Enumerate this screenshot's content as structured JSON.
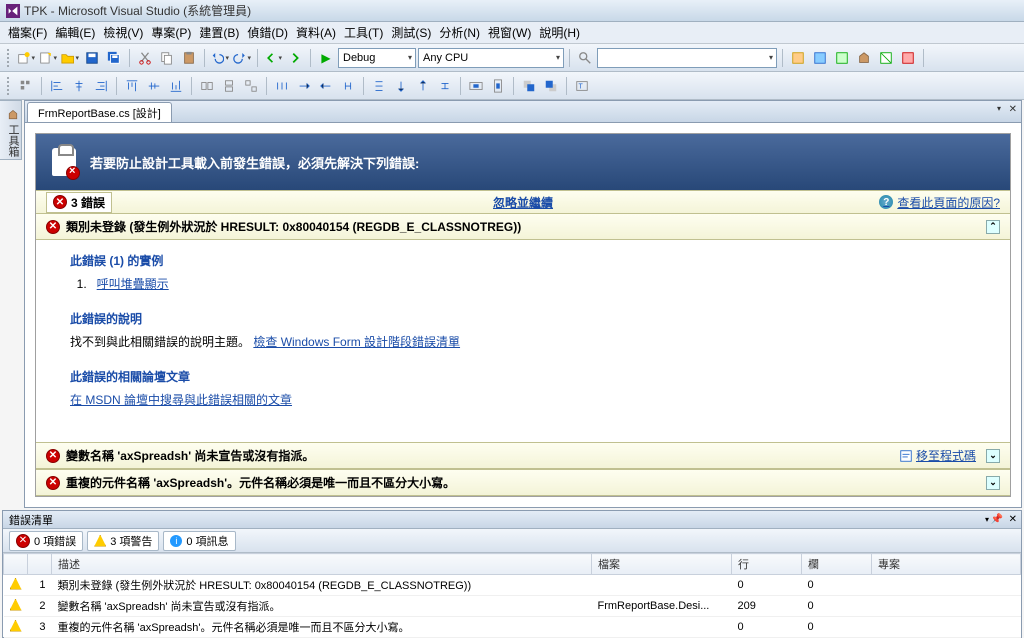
{
  "title": "TPK - Microsoft Visual Studio (系統管理員)",
  "menu": [
    {
      "label": "檔案(F)"
    },
    {
      "label": "編輯(E)"
    },
    {
      "label": "檢視(V)"
    },
    {
      "label": "專案(P)"
    },
    {
      "label": "建置(B)"
    },
    {
      "label": "偵錯(D)"
    },
    {
      "label": "資料(A)"
    },
    {
      "label": "工具(T)"
    },
    {
      "label": "測試(S)"
    },
    {
      "label": "分析(N)"
    },
    {
      "label": "視窗(W)"
    },
    {
      "label": "說明(H)"
    }
  ],
  "toolbar": {
    "config": "Debug",
    "platform": "Any CPU",
    "blank": ""
  },
  "lefttab": "工具箱",
  "doc": {
    "tab": "FrmReportBase.cs [設計]",
    "banner": "若要防止設計工具載入前發生錯誤，必須先解決下列錯誤:",
    "errcount": "3 錯誤",
    "ignore": "忽略並繼續",
    "why": "查看此頁面的原因?",
    "err1_title": "類別未登錄 (發生例外狀況於 HRESULT: 0x80040154 (REGDB_E_CLASSNOTREG))",
    "sec1_h": "此錯誤 (1) 的實例",
    "sec1_link": "呼叫堆疊顯示",
    "sec2_h": "此錯誤的說明",
    "sec2_txt": "找不到與此相關錯誤的說明主題。",
    "sec2_link": "檢查 Windows Form 設計階段錯誤清單",
    "sec3_h": "此錯誤的相關論壇文章",
    "sec3_link": "在 MSDN 論壇中搜尋與此錯誤相關的文章",
    "err2": "變數名稱 'axSpreadsh' 尚未宣告或沒有指派。",
    "goto": "移至程式碼",
    "err3": "重複的元件名稱 'axSpreadsh'。元件名稱必須是唯一而且不區分大小寫。"
  },
  "errorlist": {
    "title": "錯誤清單",
    "f_err": "0 項錯誤",
    "f_warn": "3 項警告",
    "f_msg": "0 項訊息",
    "cols": {
      "desc": "描述",
      "file": "檔案",
      "line": "行",
      "col": "欄",
      "proj": "專案"
    },
    "rows": [
      {
        "n": "1",
        "desc": "類別未登錄 (發生例外狀況於 HRESULT: 0x80040154 (REGDB_E_CLASSNOTREG))",
        "file": "",
        "line": "0",
        "col": "0",
        "proj": ""
      },
      {
        "n": "2",
        "desc": "變數名稱 'axSpreadsh' 尚未宣告或沒有指派。",
        "file": "FrmReportBase.Desi...",
        "line": "209",
        "col": "0",
        "proj": ""
      },
      {
        "n": "3",
        "desc": "重複的元件名稱 'axSpreadsh'。元件名稱必須是唯一而且不區分大小寫。",
        "file": "",
        "line": "0",
        "col": "0",
        "proj": ""
      }
    ]
  }
}
